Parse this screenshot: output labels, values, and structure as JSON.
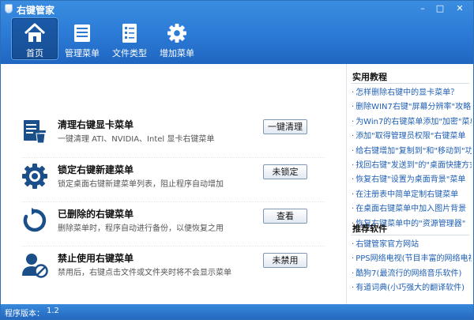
{
  "window": {
    "title": "右键管家",
    "controls": [
      "–",
      "□",
      "✕"
    ]
  },
  "nav": {
    "items": [
      {
        "label": "首页",
        "icon": "home-icon",
        "active": true
      },
      {
        "label": "管理菜单",
        "icon": "menu-list-icon",
        "active": false
      },
      {
        "label": "文件类型",
        "icon": "file-types-icon",
        "active": false
      },
      {
        "label": "增加菜单",
        "icon": "gear-icon",
        "active": false
      }
    ]
  },
  "features": [
    {
      "title": "清理右键显卡菜单",
      "desc": "一键清理 ATI、NVIDIA、Intel 显卡右键菜单",
      "button": "一键清理",
      "icon": "trash-icon"
    },
    {
      "title": "锁定右键新建菜单",
      "desc": "锁定桌面右键新建菜单列表，阻止程序自动增加",
      "button": "未锁定",
      "icon": "gear-lock-icon"
    },
    {
      "title": "已删除的右键菜单",
      "desc": "删除菜单时，程序自动进行备份，以便恢复之用",
      "button": "查看",
      "icon": "restore-icon"
    },
    {
      "title": "禁止使用右键菜单",
      "desc": "禁用后，右键点击文件或文件夹时将不会显示菜单",
      "button": "未禁用",
      "icon": "user-block-icon"
    }
  ],
  "sidebar": {
    "tutorials_title": "实用教程",
    "tutorials": [
      "怎样删除右键中的显卡菜单？",
      "删除WIN7右键\"屏幕分辨率\"攻略",
      "为Win7的右键菜单添加\"加密\"菜单",
      "添加\"取得管理员权限\"右键菜单",
      "给右键增加\"复制到\"和\"移动到\"功能",
      "找回右键\"发送到\"的\"桌面快捷方式\"",
      "恢复右键\"设置为桌面背景\"菜单",
      "在注册表中简单定制右键菜单",
      "在桌面右键菜单中加入图片背景",
      "恢复右键菜单中的\"资源管理器\""
    ],
    "software_title": "推荐软件",
    "software": [
      "右键管家官方网站",
      "PPS网络电视(节目丰富的网络电视)",
      "酷狗7(最流行的网络音乐软件)",
      "有道词典(小巧强大的翻译软件)"
    ]
  },
  "footer": {
    "label": "程序版本：",
    "version": "1.2"
  },
  "colors": {
    "header": "#2b7ad6",
    "link": "#1f5fb4",
    "footer": "#2468be"
  }
}
